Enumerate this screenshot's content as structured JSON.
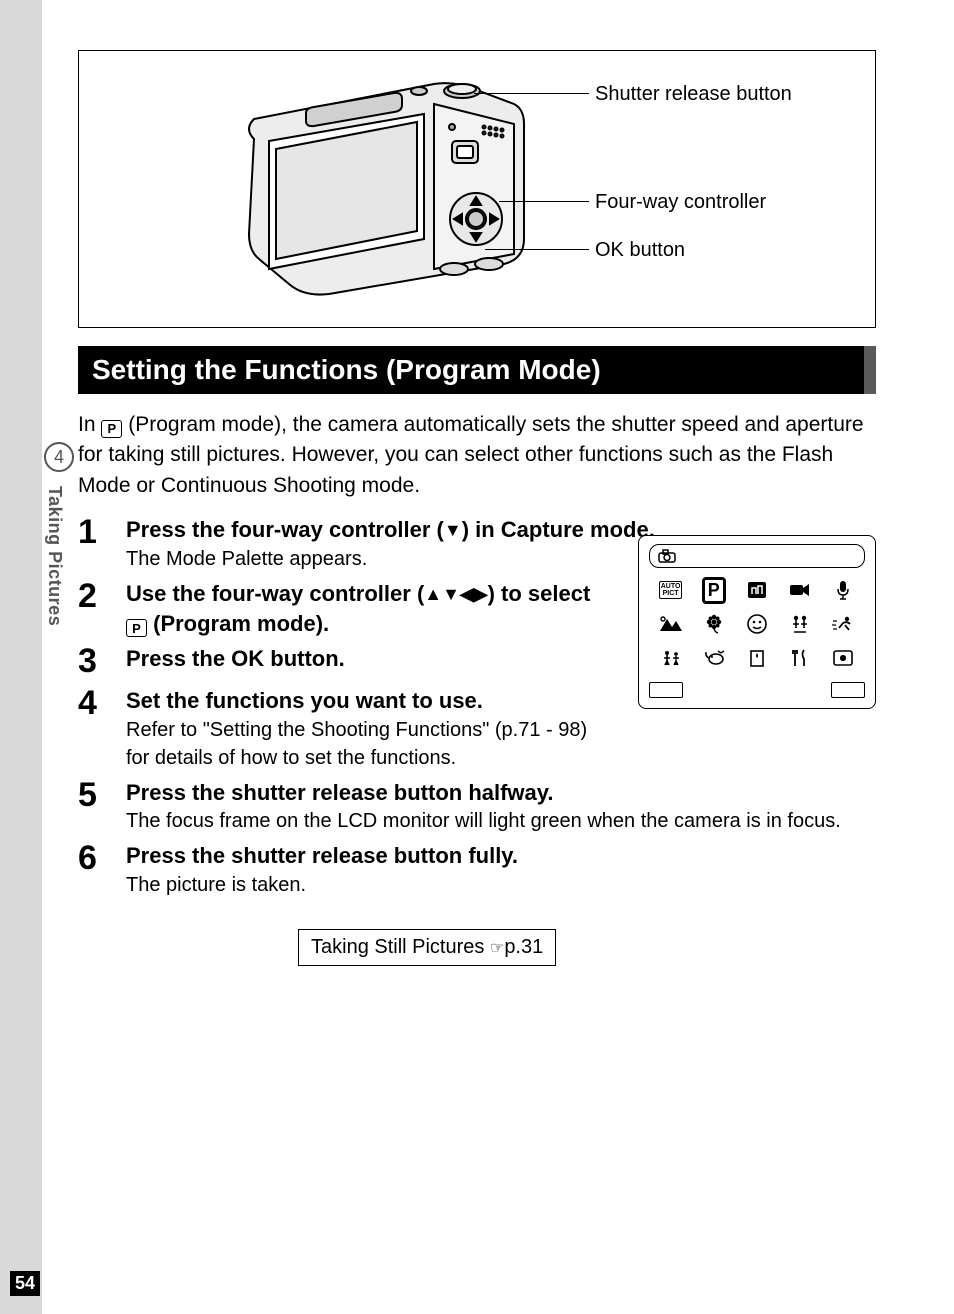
{
  "diagram": {
    "callouts": {
      "shutter": "Shutter release button",
      "fourway": "Four-way controller",
      "ok": "OK button"
    }
  },
  "heading": "Setting the Functions (Program Mode)",
  "intro": {
    "prefix": "In ",
    "p_label": "P",
    "suffix": " (Program mode), the camera automatically sets the shutter speed and aperture for taking still pictures. However, you can select other functions such as the Flash Mode or Continuous Shooting mode."
  },
  "steps": [
    {
      "num": "1",
      "title_parts": [
        "Press the four-way controller (",
        "▼",
        ") in Capture mode."
      ],
      "desc": "The Mode Palette appears."
    },
    {
      "num": "2",
      "title_parts": [
        "Use the four-way controller (",
        "▲▼◀▶",
        ") to select ",
        "P",
        " (Program mode)."
      ],
      "desc": ""
    },
    {
      "num": "3",
      "title_parts": [
        "Press the OK button."
      ],
      "desc": ""
    },
    {
      "num": "4",
      "title_parts": [
        "Set the functions you want to use."
      ],
      "desc": "Refer to \"Setting the Shooting Functions\" (p.71 - 98) for details of how to set the functions."
    },
    {
      "num": "5",
      "title_parts": [
        "Press the shutter release button halfway."
      ],
      "desc": "The focus frame on the LCD monitor will light green when the camera is in focus."
    },
    {
      "num": "6",
      "title_parts": [
        "Press the shutter release button fully."
      ],
      "desc": "The picture is taken."
    }
  ],
  "mode_palette": {
    "p_label": "P",
    "auto_label": "AUTO\nPICT"
  },
  "ref": {
    "text": "Taking Still Pictures ",
    "page": "p.31"
  },
  "sidebar": {
    "chapter": "4",
    "label": "Taking Pictures"
  },
  "page_num": "54"
}
